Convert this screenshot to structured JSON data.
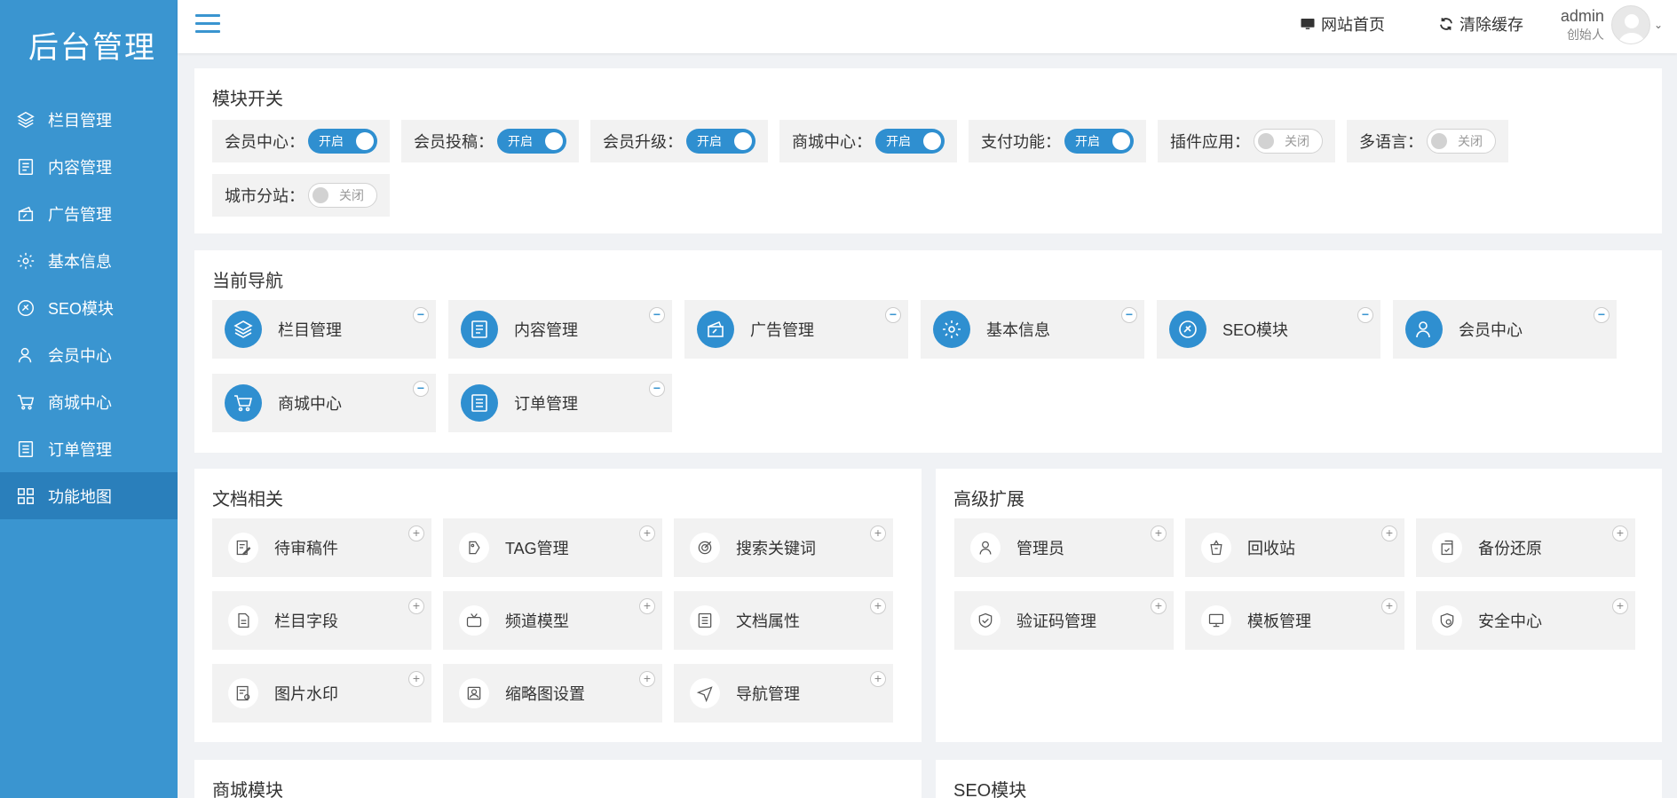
{
  "app": {
    "logo": "后台管理"
  },
  "sidebar": {
    "items": [
      {
        "label": "栏目管理",
        "icon": "layers-icon"
      },
      {
        "label": "内容管理",
        "icon": "document-icon"
      },
      {
        "label": "广告管理",
        "icon": "ad-icon"
      },
      {
        "label": "基本信息",
        "icon": "gear-icon"
      },
      {
        "label": "SEO模块",
        "icon": "seo-icon"
      },
      {
        "label": "会员中心",
        "icon": "user-icon"
      },
      {
        "label": "商城中心",
        "icon": "cart-icon"
      },
      {
        "label": "订单管理",
        "icon": "list-icon"
      },
      {
        "label": "功能地图",
        "icon": "grid-icon",
        "active": true
      }
    ]
  },
  "header": {
    "site_home": "网站首页",
    "clear_cache": "清除缓存",
    "username": "admin",
    "role": "创始人"
  },
  "modules": {
    "title": "模块开关",
    "switches": [
      {
        "label": "会员中心：",
        "state": "开启",
        "on": true
      },
      {
        "label": "会员投稿：",
        "state": "开启",
        "on": true
      },
      {
        "label": "会员升级：",
        "state": "开启",
        "on": true
      },
      {
        "label": "商城中心：",
        "state": "开启",
        "on": true
      },
      {
        "label": "支付功能：",
        "state": "开启",
        "on": true
      },
      {
        "label": "插件应用：",
        "state": "关闭",
        "on": false
      },
      {
        "label": "多语言：",
        "state": "关闭",
        "on": false
      },
      {
        "label": "城市分站：",
        "state": "关闭",
        "on": false
      }
    ]
  },
  "current_nav": {
    "title": "当前导航",
    "items": [
      {
        "label": "栏目管理",
        "icon": "layers-icon"
      },
      {
        "label": "内容管理",
        "icon": "document-icon"
      },
      {
        "label": "广告管理",
        "icon": "ad-icon"
      },
      {
        "label": "基本信息",
        "icon": "gear-icon"
      },
      {
        "label": "SEO模块",
        "icon": "seo-icon"
      },
      {
        "label": "会员中心",
        "icon": "user-icon"
      },
      {
        "label": "商城中心",
        "icon": "cart-icon"
      },
      {
        "label": "订单管理",
        "icon": "list-icon"
      }
    ],
    "remove_symbol": "−"
  },
  "docs": {
    "title": "文档相关",
    "items": [
      {
        "label": "待审稿件",
        "icon": "edit-icon"
      },
      {
        "label": "TAG管理",
        "icon": "tag-icon"
      },
      {
        "label": "搜索关键词",
        "icon": "target-icon"
      },
      {
        "label": "栏目字段",
        "icon": "file-icon"
      },
      {
        "label": "频道模型",
        "icon": "tv-icon"
      },
      {
        "label": "文档属性",
        "icon": "doc-list-icon"
      },
      {
        "label": "图片水印",
        "icon": "watermark-icon"
      },
      {
        "label": "缩略图设置",
        "icon": "image-icon"
      },
      {
        "label": "导航管理",
        "icon": "send-icon"
      }
    ],
    "add_symbol": "+"
  },
  "advanced": {
    "title": "高级扩展",
    "items": [
      {
        "label": "管理员",
        "icon": "admin-user-icon"
      },
      {
        "label": "回收站",
        "icon": "recycle-icon"
      },
      {
        "label": "备份还原",
        "icon": "backup-icon"
      },
      {
        "label": "验证码管理",
        "icon": "shield-check-icon"
      },
      {
        "label": "模板管理",
        "icon": "monitor-icon"
      },
      {
        "label": "安全中心",
        "icon": "security-icon"
      }
    ]
  },
  "bottom": {
    "shop_title": "商城模块",
    "seo_title": "SEO模块"
  },
  "colors": {
    "primary": "#3a95d0",
    "sidebar_active": "#2a7fbb"
  }
}
